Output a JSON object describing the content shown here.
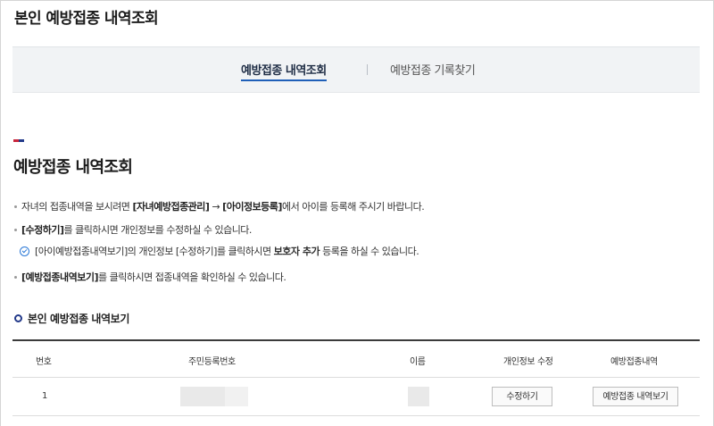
{
  "page": {
    "title": "본인 예방접종 내역조회"
  },
  "tabs": [
    {
      "label": "예방접종 내역조회",
      "active": true
    },
    {
      "label": "예방접종 기록찾기",
      "active": false
    }
  ],
  "section": {
    "title": "예방접종 내역조회"
  },
  "notes": {
    "n1_a": "자녀의 접종내역을 보시려면 ",
    "n1_b": "[자녀예방접종관리]",
    "n1_c": " → ",
    "n1_d": "[아이정보등록]",
    "n1_e": "에서 아이를 등록해 주시기 바랍니다.",
    "n2_a": "[수정하기]",
    "n2_b": "를 클릭하시면 개인정보를 수정하실 수 있습니다.",
    "n3_a": "[아이예방접종내역보기]의 개인정보 [수정하기]를 클릭하시면 ",
    "n3_b": "보호자 추가",
    "n3_c": " 등록을 하실 수 있습니다.",
    "n4_a": "[예방접종내역보기]",
    "n4_b": "를 클릭하시면 접종내역을 확인하실 수 있습니다."
  },
  "subsection": {
    "title": "본인 예방접종 내역보기"
  },
  "table": {
    "headers": [
      "번호",
      "주민등록번호",
      "이름",
      "개인정보 수정",
      "예방접종내역"
    ],
    "rows": [
      {
        "no": "1",
        "edit_label": "수정하기",
        "view_label": "예방접종 내역보기"
      }
    ]
  },
  "colors": {
    "accent": "#1f5fb8",
    "navy": "#233a8a",
    "red": "#c9253b",
    "tab_bg": "#f1f3f5"
  },
  "icons": {
    "note_check": "check-circle-icon",
    "subsection": "circle-outline-icon"
  }
}
